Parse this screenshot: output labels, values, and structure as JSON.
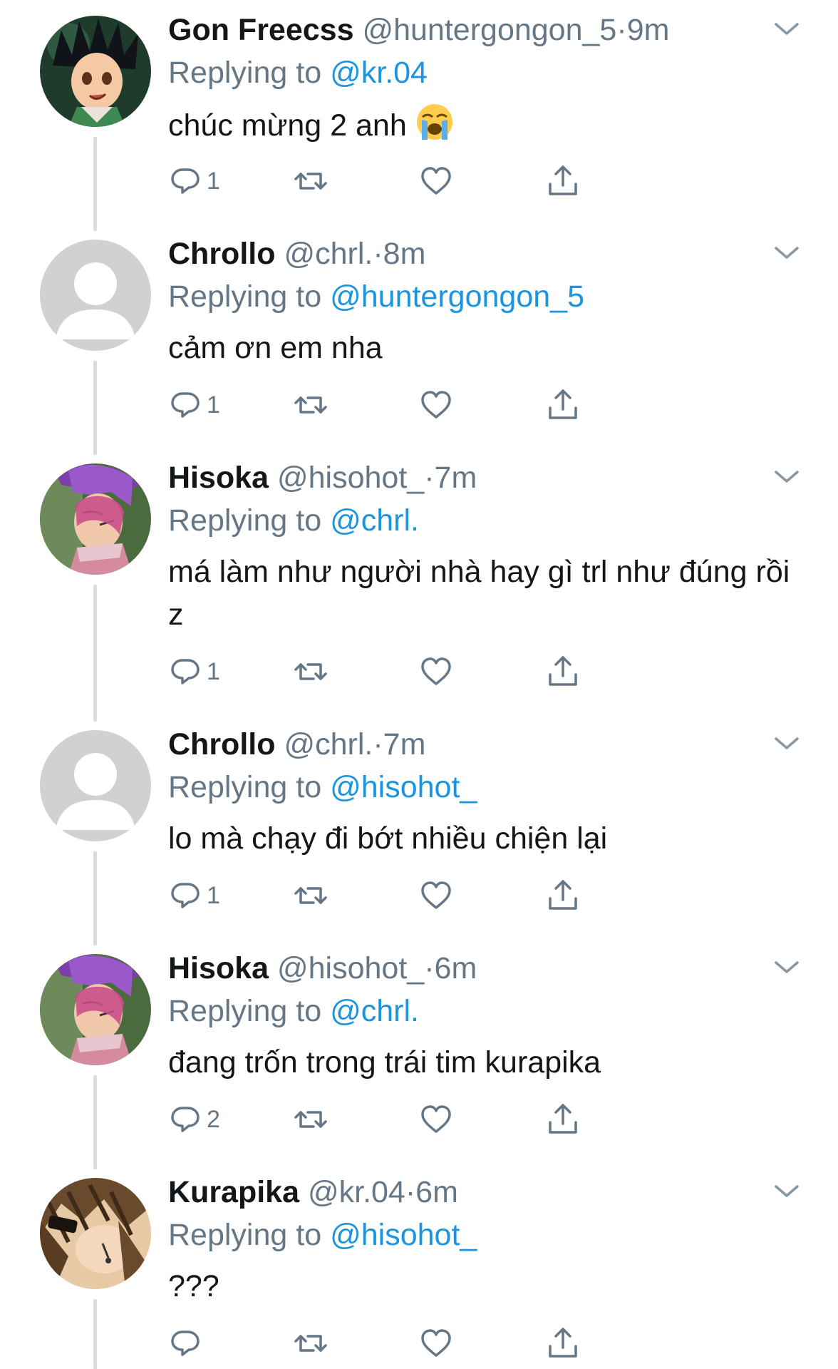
{
  "tweets": [
    {
      "name": "Gon Freecss",
      "handle": "@huntergongon_5",
      "separator": "·",
      "time": "9m",
      "reply_prefix": "Replying to",
      "reply_to": "@kr.04",
      "text": "chúc mừng 2 anh",
      "emoji": "loudly-crying-face",
      "reply_count": "1",
      "avatar": "gon-avatar"
    },
    {
      "name": "Chrollo",
      "handle": "@chrl.",
      "separator": "·",
      "time": "8m",
      "reply_prefix": "Replying to",
      "reply_to": "@huntergongon_5",
      "text": "cảm ơn em nha",
      "reply_count": "1",
      "avatar": "default-avatar"
    },
    {
      "name": "Hisoka",
      "handle": "@hisohot_",
      "separator": "·",
      "time": "7m",
      "reply_prefix": "Replying to",
      "reply_to": "@chrl.",
      "text": "má làm như người nhà hay gì trl như đúng rồi z",
      "reply_count": "1",
      "avatar": "hisoka-avatar"
    },
    {
      "name": "Chrollo",
      "handle": "@chrl.",
      "separator": "·",
      "time": "7m",
      "reply_prefix": "Replying to",
      "reply_to": "@hisohot_",
      "text": "lo mà chạy đi bớt nhiều chiện lại",
      "reply_count": "1",
      "avatar": "default-avatar"
    },
    {
      "name": "Hisoka",
      "handle": "@hisohot_",
      "separator": "·",
      "time": "6m",
      "reply_prefix": "Replying to",
      "reply_to": "@chrl.",
      "text": "đang trốn trong trái tim kurapika",
      "reply_count": "2",
      "avatar": "hisoka-avatar"
    },
    {
      "name": "Kurapika",
      "handle": "@kr.04",
      "separator": "·",
      "time": "6m",
      "reply_prefix": "Replying to",
      "reply_to": "@hisohot_",
      "text": "???",
      "reply_count": "",
      "avatar": "kurapika-avatar"
    }
  ],
  "colors": {
    "link": "#1b95e0",
    "muted": "#657786",
    "text": "#14171a",
    "thread_line": "#d7dde2"
  },
  "icons": {
    "reply": "reply-icon",
    "retweet": "retweet-icon",
    "like": "heart-icon",
    "share": "share-icon",
    "more": "chevron-down-icon"
  }
}
